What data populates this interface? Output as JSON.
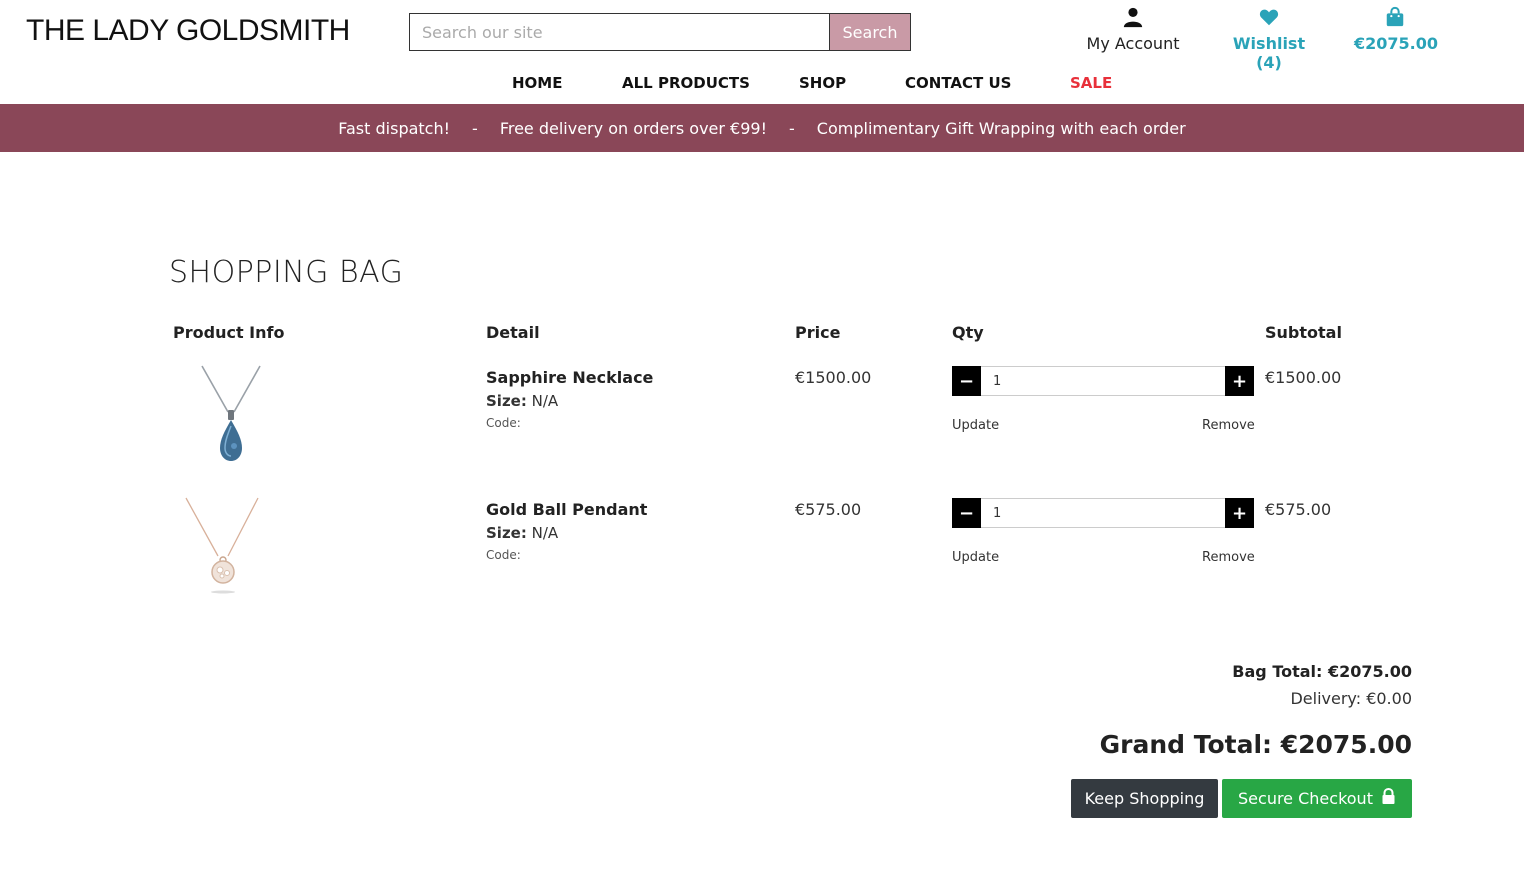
{
  "header": {
    "logo": "THE LADY GOLDSMITH",
    "search": {
      "placeholder": "Search our site",
      "button": "Search"
    },
    "account": {
      "label": "My Account",
      "icon": "user-icon"
    },
    "wishlist": {
      "label": "Wishlist (4)",
      "icon": "heart-icon"
    },
    "bag": {
      "label": "€2075.00",
      "icon": "shopping-bag-icon"
    }
  },
  "nav": {
    "home": "HOME",
    "all_products": "ALL PRODUCTS",
    "shop": "SHOP",
    "contact": "CONTACT US",
    "sale": "SALE"
  },
  "banner": {
    "item1": "Fast dispatch!",
    "sep1": "-",
    "item2": "Free delivery on orders over €99!",
    "sep2": "-",
    "item3": "Complimentary Gift Wrapping with each order"
  },
  "page_title": "SHOPPING BAG",
  "columns": {
    "product_info": "Product Info",
    "detail": "Detail",
    "price": "Price",
    "qty": "Qty",
    "subtotal": "Subtotal"
  },
  "items": [
    {
      "name": "Sapphire Necklace",
      "size_label": "Size:",
      "size": "N/A",
      "code": "Code:",
      "price": "€1500.00",
      "qty": "1",
      "minus": "−",
      "plus": "+",
      "update": "Update",
      "remove": "Remove",
      "subtotal": "€1500.00"
    },
    {
      "name": "Gold Ball Pendant",
      "size_label": "Size:",
      "size": "N/A",
      "code": "Code:",
      "price": "€575.00",
      "qty": "1",
      "minus": "−",
      "plus": "+",
      "update": "Update",
      "remove": "Remove",
      "subtotal": "€575.00"
    }
  ],
  "totals": {
    "bag_total": "Bag Total: €2075.00",
    "delivery": "Delivery: €0.00",
    "grand_total": "Grand Total: €2075.00"
  },
  "buttons": {
    "keep_shopping": "Keep Shopping",
    "secure_checkout": "Secure Checkout"
  },
  "colors": {
    "banner": "#8a4758",
    "accent": "#2aa3b8",
    "sale": "#e8303a",
    "checkout": "#28a745",
    "keep_shopping": "#343a40",
    "search_button": "#c99aa6"
  }
}
